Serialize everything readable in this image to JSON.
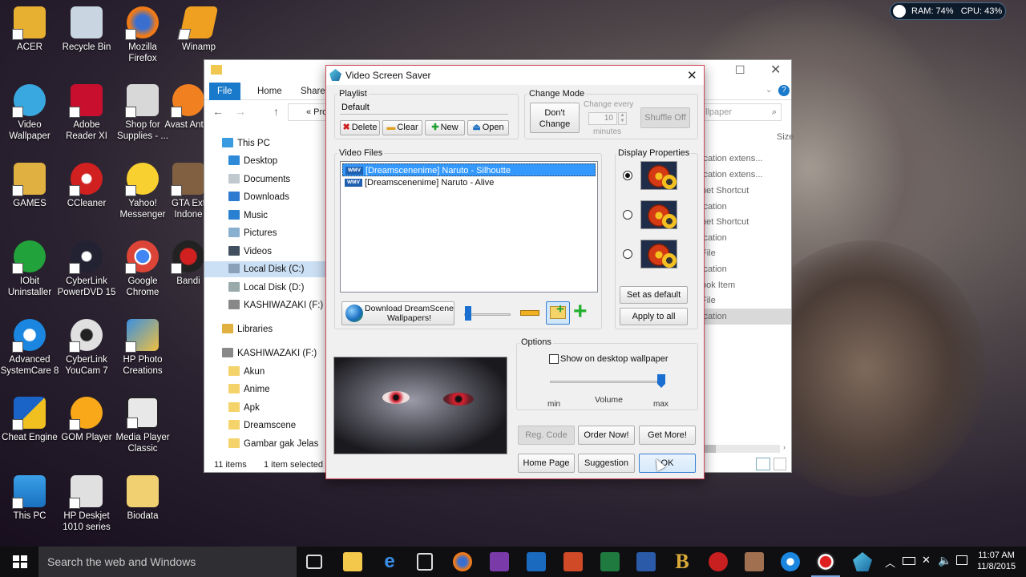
{
  "system_monitor": {
    "ram": "RAM: 74%",
    "cpu": "CPU: 43%"
  },
  "desktop_icons": [
    {
      "label": "ACER"
    },
    {
      "label": "Recycle Bin"
    },
    {
      "label": "Mozilla Firefox"
    },
    {
      "label": "Winamp"
    },
    {
      "label": "Video Wallpaper"
    },
    {
      "label": "Adobe Reader XI"
    },
    {
      "label": "Shop for Supplies - ..."
    },
    {
      "label": "Avast Antivi"
    },
    {
      "label": "GAMES"
    },
    {
      "label": "CCleaner"
    },
    {
      "label": "Yahoo! Messenger"
    },
    {
      "label": "GTA Ext Indone"
    },
    {
      "label": "IObit Uninstaller"
    },
    {
      "label": "CyberLink PowerDVD 15"
    },
    {
      "label": "Google Chrome"
    },
    {
      "label": "Bandi"
    },
    {
      "label": "Advanced SystemCare 8"
    },
    {
      "label": "CyberLink YouCam 7"
    },
    {
      "label": "HP Photo Creations"
    },
    {
      "label": "Cheat Engine"
    },
    {
      "label": "GOM Player"
    },
    {
      "label": "Media Player Classic"
    },
    {
      "label": "This PC"
    },
    {
      "label": "HP Deskjet 1010 series"
    },
    {
      "label": "Biodata"
    }
  ],
  "explorer": {
    "ribbon_tabs": [
      "File",
      "Home",
      "Share"
    ],
    "address": "« Pro",
    "search_placeholder": "llpaper",
    "column_header": "Size",
    "nav": [
      "This PC",
      "Desktop",
      "Documents",
      "Downloads",
      "Music",
      "Pictures",
      "Videos",
      "Local Disk (C:)",
      "Local Disk (D:)",
      "KASHIWAZAKI (F:)",
      "Libraries",
      "KASHIWAZAKI (F:)",
      "Akun",
      "Anime",
      "Apk",
      "Dreamscene",
      "Gambar gak Jelas"
    ],
    "right_items": [
      "ication extens...",
      "ication extens...",
      "net Shortcut",
      "ication",
      "net Shortcut",
      "ication",
      "File",
      "ication",
      "ook Item",
      "File",
      "ication"
    ],
    "status_count": "11 items",
    "status_selected": "1 item selected"
  },
  "dialog": {
    "title": "Video Screen Saver",
    "playlist": {
      "label": "Playlist",
      "value": "Default",
      "delete": "Delete",
      "clear": "Clear",
      "new": "New",
      "open": "Open"
    },
    "change_mode": {
      "label": "Change Mode",
      "dont_change": "Don't Change",
      "change_every": "Change every",
      "interval": "10",
      "minutes": "minutes",
      "shuffle": "Shuffle Off"
    },
    "video_files": {
      "label": "Video Files",
      "items": [
        "[Dreamscenenime] Naruto - Silhoutte",
        "[Dreamscenenime] Naruto - Alive"
      ],
      "selected_index": 0,
      "badge": "WMV"
    },
    "download_button": "Download DreamScene Wallpapers!",
    "display_properties": {
      "label": "Display Properties",
      "selected_index": 0,
      "set_default": "Set as default",
      "apply_all": "Apply to all"
    },
    "options": {
      "label": "Options",
      "show_on_desktop": "Show on desktop wallpaper",
      "show_on_desktop_checked": false,
      "volume_label": "Volume",
      "min": "min",
      "max": "max",
      "volume_level": 1.0
    },
    "buttons": {
      "reg_code": "Reg. Code",
      "order_now": "Order Now!",
      "get_more": "Get More!",
      "home_page": "Home Page",
      "suggestion": "Suggestion",
      "ok": "OK"
    }
  },
  "taskbar": {
    "search_placeholder": "Search the web and Windows",
    "time": "11:07 AM",
    "date": "11/8/2015"
  }
}
